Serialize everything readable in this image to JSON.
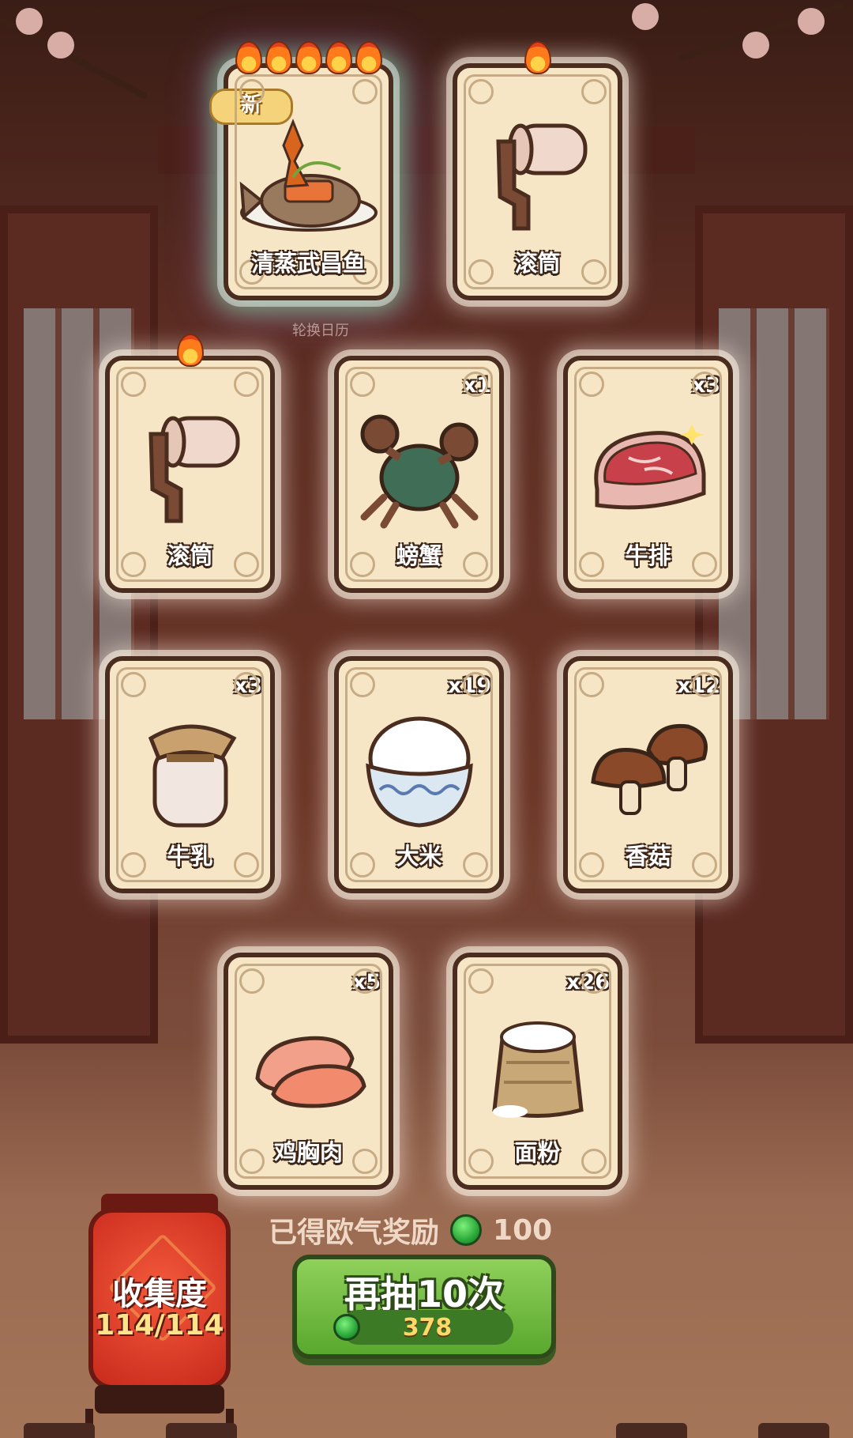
{
  "calendar_label": "轮换日历",
  "cards": [
    {
      "id": "fish",
      "name": "清蒸武昌鱼",
      "qty": "",
      "flames": 5,
      "is_new": true,
      "new_label": "新",
      "icon": "steamed-fish-icon"
    },
    {
      "id": "roller1",
      "name": "滚筒",
      "qty": "",
      "flames": 1,
      "is_new": false,
      "icon": "roller-icon"
    },
    {
      "id": "roller2",
      "name": "滚筒",
      "qty": "",
      "flames": 1,
      "is_new": false,
      "icon": "roller-icon"
    },
    {
      "id": "crab",
      "name": "螃蟹",
      "qty": "x1",
      "flames": 0,
      "is_new": false,
      "icon": "crab-icon"
    },
    {
      "id": "steak",
      "name": "牛排",
      "qty": "x3",
      "flames": 0,
      "is_new": false,
      "icon": "steak-icon"
    },
    {
      "id": "milk",
      "name": "牛乳",
      "qty": "x3",
      "flames": 0,
      "is_new": false,
      "icon": "milk-jar-icon"
    },
    {
      "id": "rice",
      "name": "大米",
      "qty": "x19",
      "flames": 0,
      "is_new": false,
      "icon": "rice-bowl-icon"
    },
    {
      "id": "mushroom",
      "name": "香菇",
      "qty": "x12",
      "flames": 0,
      "is_new": false,
      "icon": "mushroom-icon"
    },
    {
      "id": "chicken",
      "name": "鸡胸肉",
      "qty": "x5",
      "flames": 0,
      "is_new": false,
      "icon": "chicken-breast-icon"
    },
    {
      "id": "flour",
      "name": "面粉",
      "qty": "x26",
      "flames": 0,
      "is_new": false,
      "icon": "flour-sack-icon"
    }
  ],
  "reward": {
    "label": "已得欧气奖励",
    "value": "100",
    "icon": "green-coin-icon"
  },
  "draw_button": {
    "label": "再抽10次",
    "cost": "378",
    "icon": "green-coin-icon"
  },
  "collection": {
    "title": "收集度",
    "count": "114/114"
  },
  "colors": {
    "card_bg": "#f6e6c6",
    "card_border": "#4a2d1f",
    "button_green": "#6cb83a",
    "lantern_red": "#d8341f"
  }
}
